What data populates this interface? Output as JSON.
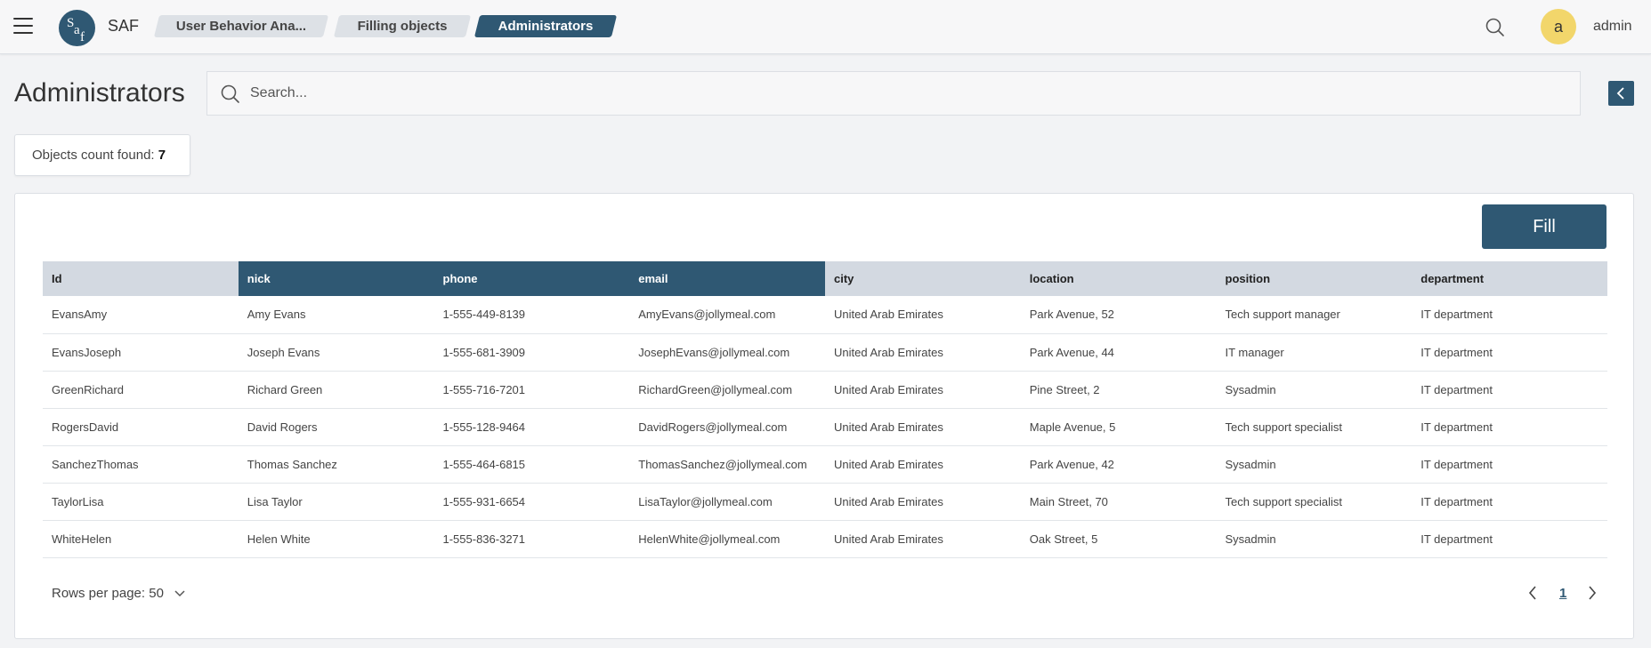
{
  "topbar": {
    "app_name": "SAF",
    "breadcrumbs": [
      {
        "label": "User Behavior Ana..."
      },
      {
        "label": "Filling objects"
      },
      {
        "label": "Administrators"
      }
    ],
    "avatar_initial": "a",
    "username": "admin"
  },
  "page": {
    "title": "Administrators",
    "search_placeholder": "Search...",
    "count_label": "Objects count found:",
    "count_value": "7"
  },
  "panel": {
    "fill_label": "Fill",
    "columns": [
      "Id",
      "nick",
      "phone",
      "email",
      "city",
      "location",
      "position",
      "department"
    ],
    "highlighted_columns": [
      "nick",
      "phone",
      "email"
    ],
    "rows": [
      [
        "EvansAmy",
        "Amy Evans",
        "1-555-449-8139",
        "AmyEvans@jollymeal.com",
        "United Arab Emirates",
        "Park Avenue, 52",
        "Tech support manager",
        "IT department"
      ],
      [
        "EvansJoseph",
        "Joseph Evans",
        "1-555-681-3909",
        "JosephEvans@jollymeal.com",
        "United Arab Emirates",
        "Park Avenue, 44",
        "IT manager",
        "IT department"
      ],
      [
        "GreenRichard",
        "Richard Green",
        "1-555-716-7201",
        "RichardGreen@jollymeal.com",
        "United Arab Emirates",
        "Pine Street, 2",
        "Sysadmin",
        "IT department"
      ],
      [
        "RogersDavid",
        "David Rogers",
        "1-555-128-9464",
        "DavidRogers@jollymeal.com",
        "United Arab Emirates",
        "Maple Avenue, 5",
        "Tech support specialist",
        "IT department"
      ],
      [
        "SanchezThomas",
        "Thomas Sanchez",
        "1-555-464-6815",
        "ThomasSanchez@jollymeal.com",
        "United Arab Emirates",
        "Park Avenue, 42",
        "Sysadmin",
        "IT department"
      ],
      [
        "TaylorLisa",
        "Lisa Taylor",
        "1-555-931-6654",
        "LisaTaylor@jollymeal.com",
        "United Arab Emirates",
        "Main Street, 70",
        "Tech support specialist",
        "IT department"
      ],
      [
        "WhiteHelen",
        "Helen White",
        "1-555-836-3271",
        "HelenWhite@jollymeal.com",
        "United Arab Emirates",
        "Oak Street, 5",
        "Sysadmin",
        "IT department"
      ]
    ],
    "rows_per_page_label": "Rows per page: 50",
    "current_page": "1"
  },
  "colors": {
    "primary": "#2f5873",
    "avatar": "#f2d66b",
    "header_row": "#d3d9e1"
  },
  "icons": {
    "menu": "hamburger-icon",
    "search": "search-icon",
    "collapse": "chevron-left-icon",
    "dropdown": "chevron-down-icon",
    "prev": "chevron-left-icon",
    "next": "chevron-right-icon"
  }
}
